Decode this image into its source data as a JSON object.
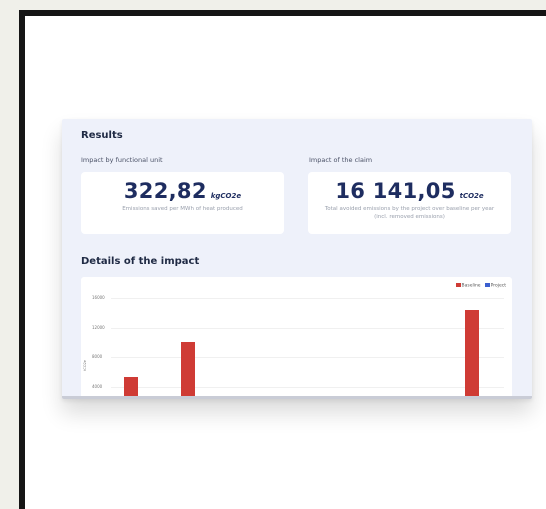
{
  "results": {
    "title": "Results",
    "functional_unit_label": "Impact by functional unit",
    "claim_label": "Impact of the claim",
    "functional_unit": {
      "value": "322,82",
      "unit": "kgCO2e",
      "description": "Emissions saved per MWh of heat produced"
    },
    "claim": {
      "value": "16 141,05",
      "unit": "tCO2e",
      "description": "Total avoided emissions by the project over baseline per year (incl. removed emissions)"
    }
  },
  "details": {
    "title": "Details of the impact"
  },
  "chart_data": {
    "type": "bar",
    "legend": [
      "Baseline",
      "Project"
    ],
    "colors": {
      "Baseline": "#cf3b35",
      "Project": "#3b5fcf"
    },
    "ylabel": "tCO2e",
    "yticks": [
      "16000",
      "12000",
      "8000",
      "4000"
    ],
    "ylim": [
      0,
      16000
    ],
    "series": [
      {
        "name": "Baseline",
        "values": [
          4200,
          9000,
          13500
        ]
      }
    ],
    "legend_position": "top-right",
    "grid": true
  }
}
